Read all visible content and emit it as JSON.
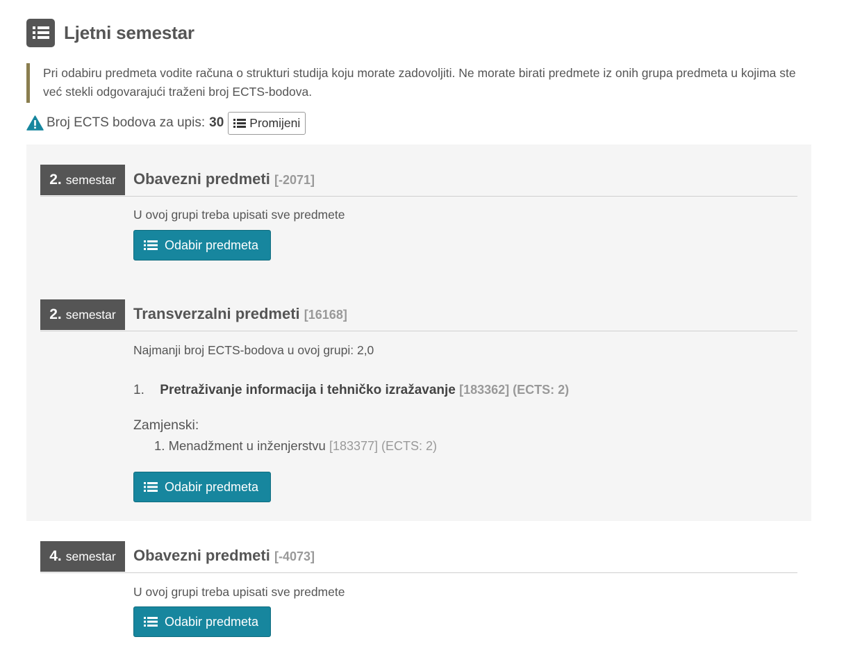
{
  "header": {
    "title": "Ljetni semestar",
    "icon": "list-icon"
  },
  "notice": {
    "text": "Pri odabiru predmeta vodite računa o strukturi studija koju morate zadovoljiti. Ne morate birati predmete iz onih grupa predmeta u kojima ste već stekli odgovarajući traženi broj ECTS-bodova."
  },
  "ects": {
    "icon": "warning-icon",
    "label": "Broj ECTS bodova za upis:",
    "value": "30",
    "change_label": "Promijeni"
  },
  "colors": {
    "accent_button": "#17869e",
    "badge": "#555555",
    "notice_border": "#8a7e4f",
    "panel_bg": "#f5f5f5"
  },
  "groups": [
    {
      "sem_num": "2.",
      "sem_word": "semestar",
      "title": "Obavezni predmeti",
      "code": "[-2071]",
      "note": "U ovoj grupi treba upisati sve predmete",
      "button_label": "Odabir predmeta"
    },
    {
      "sem_num": "2.",
      "sem_word": "semestar",
      "title": "Transverzalni predmeti",
      "code": "[16168]",
      "note": "Najmanji broj ECTS-bodova u ovoj grupi: 2,0",
      "course": {
        "num": "1.",
        "name": "Pretraživanje informacija i tehničko izražavanje",
        "meta": "[183362] (ECTS: 2)"
      },
      "replacement_label": "Zamjenski:",
      "replacement": {
        "text": "1. Menadžment u inženjerstvu",
        "meta": "[183377] (ECTS: 2)"
      },
      "button_label": "Odabir predmeta"
    },
    {
      "sem_num": "4.",
      "sem_word": "semestar",
      "title": "Obavezni predmeti",
      "code": "[-4073]",
      "note": "U ovoj grupi treba upisati sve predmete",
      "button_label": "Odabir predmeta"
    }
  ]
}
